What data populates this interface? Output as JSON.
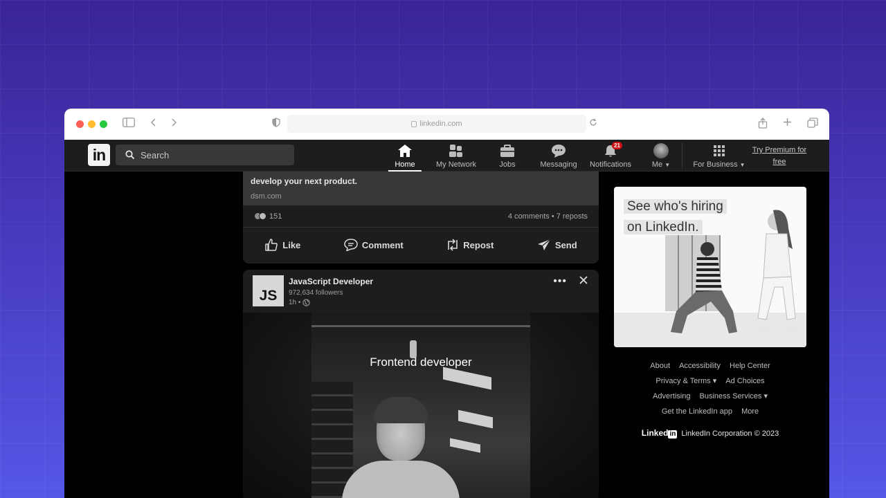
{
  "browser": {
    "url": "linkedin.com"
  },
  "nav": {
    "search_placeholder": "Search",
    "items": [
      {
        "label": "Home"
      },
      {
        "label": "My Network"
      },
      {
        "label": "Jobs"
      },
      {
        "label": "Messaging"
      },
      {
        "label": "Notifications",
        "badge": "21"
      },
      {
        "label": "Me"
      },
      {
        "label": "For Business"
      }
    ],
    "premium_line1": "Try Premium for",
    "premium_line2": "free"
  },
  "post1": {
    "title": "develop your next product.",
    "domain": "dsm.com",
    "reactions_count": "151",
    "stats": "4 comments • 7 reposts",
    "actions": {
      "like": "Like",
      "comment": "Comment",
      "repost": "Repost",
      "send": "Send"
    }
  },
  "post2": {
    "logo_text": "JS",
    "author": "JavaScript Developer",
    "followers": "972,634 followers",
    "time": "1h •",
    "video_title": "Frontend developer"
  },
  "ad": {
    "line1": "See who's hiring",
    "line2": "on LinkedIn."
  },
  "footer": {
    "row1": [
      "About",
      "Accessibility",
      "Help Center"
    ],
    "row2": [
      "Privacy & Terms ▾",
      "Ad Choices"
    ],
    "row3": [
      "Advertising",
      "Business Services ▾"
    ],
    "row4": [
      "Get the LinkedIn app",
      "More"
    ],
    "brand": "Linked",
    "brand_box": "in",
    "copyright": "LinkedIn Corporation © 2023"
  },
  "colors": {
    "background_top": "#3a2496",
    "background_bottom": "#5457e6",
    "nav_bg": "#1d1d1d",
    "card_bg": "#1d1d1d"
  }
}
